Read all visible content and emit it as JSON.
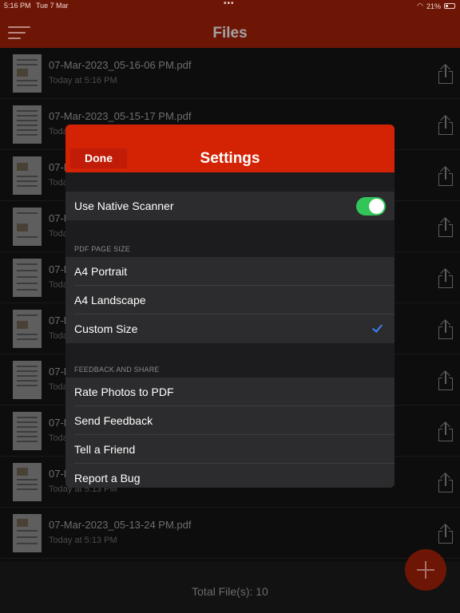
{
  "status_bar": {
    "time": "5:16 PM",
    "date": "Tue 7 Mar",
    "dots": "•••",
    "battery_percent": "21%",
    "battery_level": 0.21
  },
  "nav": {
    "title": "Files"
  },
  "files": [
    {
      "name": "07-Mar-2023_05-16-06 PM.pdf",
      "date": "Today at 5:16 PM"
    },
    {
      "name": "07-Mar-2023_05-15-17 PM.pdf",
      "date": "Toda"
    },
    {
      "name": "07-N",
      "date": "Toda"
    },
    {
      "name": "07-N",
      "date": "Toda"
    },
    {
      "name": "07-N",
      "date": "Toda"
    },
    {
      "name": "07-N",
      "date": "Toda"
    },
    {
      "name": "07-N",
      "date": "Toda"
    },
    {
      "name": "07-N",
      "date": "Toda"
    },
    {
      "name": "07-N",
      "date": "Today at 5:13 PM"
    },
    {
      "name": "07-Mar-2023_05-13-24 PM.pdf",
      "date": "Today at 5:13 PM"
    }
  ],
  "footer": {
    "total_label": "Total File(s): 10"
  },
  "settings": {
    "title": "Settings",
    "done_label": "Done",
    "native_scanner": {
      "label": "Use Native Scanner",
      "enabled": true
    },
    "pdf_page_size": {
      "header": "PDF PAGE SIZE",
      "options": [
        "A4 Portrait",
        "A4 Landscape",
        "Custom Size"
      ],
      "selected": "Custom Size"
    },
    "feedback": {
      "header": "FEEDBACK AND SHARE",
      "items": [
        "Rate Photos to PDF",
        "Send Feedback",
        "Tell a Friend",
        "Report a Bug"
      ]
    }
  },
  "colors": {
    "nav_bar": "#6e1606",
    "modal_header": "#d42304",
    "toggle_on": "#32c659",
    "checkmark": "#3a82f7"
  },
  "icons": [
    "menu-icon",
    "share-icon",
    "wifi-icon",
    "battery-icon",
    "check-icon",
    "plus-icon"
  ]
}
